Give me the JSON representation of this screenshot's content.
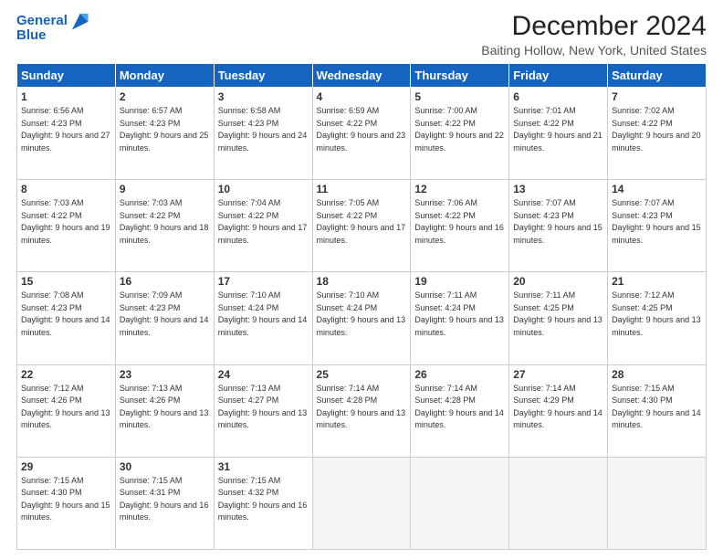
{
  "logo": {
    "line1": "General",
    "line2": "Blue"
  },
  "title": "December 2024",
  "subtitle": "Baiting Hollow, New York, United States",
  "days_header": [
    "Sunday",
    "Monday",
    "Tuesday",
    "Wednesday",
    "Thursday",
    "Friday",
    "Saturday"
  ],
  "weeks": [
    [
      {
        "day": "1",
        "sunrise": "6:56 AM",
        "sunset": "4:23 PM",
        "daylight": "9 hours and 27 minutes."
      },
      {
        "day": "2",
        "sunrise": "6:57 AM",
        "sunset": "4:23 PM",
        "daylight": "9 hours and 25 minutes."
      },
      {
        "day": "3",
        "sunrise": "6:58 AM",
        "sunset": "4:23 PM",
        "daylight": "9 hours and 24 minutes."
      },
      {
        "day": "4",
        "sunrise": "6:59 AM",
        "sunset": "4:22 PM",
        "daylight": "9 hours and 23 minutes."
      },
      {
        "day": "5",
        "sunrise": "7:00 AM",
        "sunset": "4:22 PM",
        "daylight": "9 hours and 22 minutes."
      },
      {
        "day": "6",
        "sunrise": "7:01 AM",
        "sunset": "4:22 PM",
        "daylight": "9 hours and 21 minutes."
      },
      {
        "day": "7",
        "sunrise": "7:02 AM",
        "sunset": "4:22 PM",
        "daylight": "9 hours and 20 minutes."
      }
    ],
    [
      {
        "day": "8",
        "sunrise": "7:03 AM",
        "sunset": "4:22 PM",
        "daylight": "9 hours and 19 minutes."
      },
      {
        "day": "9",
        "sunrise": "7:03 AM",
        "sunset": "4:22 PM",
        "daylight": "9 hours and 18 minutes."
      },
      {
        "day": "10",
        "sunrise": "7:04 AM",
        "sunset": "4:22 PM",
        "daylight": "9 hours and 17 minutes."
      },
      {
        "day": "11",
        "sunrise": "7:05 AM",
        "sunset": "4:22 PM",
        "daylight": "9 hours and 17 minutes."
      },
      {
        "day": "12",
        "sunrise": "7:06 AM",
        "sunset": "4:22 PM",
        "daylight": "9 hours and 16 minutes."
      },
      {
        "day": "13",
        "sunrise": "7:07 AM",
        "sunset": "4:23 PM",
        "daylight": "9 hours and 15 minutes."
      },
      {
        "day": "14",
        "sunrise": "7:07 AM",
        "sunset": "4:23 PM",
        "daylight": "9 hours and 15 minutes."
      }
    ],
    [
      {
        "day": "15",
        "sunrise": "7:08 AM",
        "sunset": "4:23 PM",
        "daylight": "9 hours and 14 minutes."
      },
      {
        "day": "16",
        "sunrise": "7:09 AM",
        "sunset": "4:23 PM",
        "daylight": "9 hours and 14 minutes."
      },
      {
        "day": "17",
        "sunrise": "7:10 AM",
        "sunset": "4:24 PM",
        "daylight": "9 hours and 14 minutes."
      },
      {
        "day": "18",
        "sunrise": "7:10 AM",
        "sunset": "4:24 PM",
        "daylight": "9 hours and 13 minutes."
      },
      {
        "day": "19",
        "sunrise": "7:11 AM",
        "sunset": "4:24 PM",
        "daylight": "9 hours and 13 minutes."
      },
      {
        "day": "20",
        "sunrise": "7:11 AM",
        "sunset": "4:25 PM",
        "daylight": "9 hours and 13 minutes."
      },
      {
        "day": "21",
        "sunrise": "7:12 AM",
        "sunset": "4:25 PM",
        "daylight": "9 hours and 13 minutes."
      }
    ],
    [
      {
        "day": "22",
        "sunrise": "7:12 AM",
        "sunset": "4:26 PM",
        "daylight": "9 hours and 13 minutes."
      },
      {
        "day": "23",
        "sunrise": "7:13 AM",
        "sunset": "4:26 PM",
        "daylight": "9 hours and 13 minutes."
      },
      {
        "day": "24",
        "sunrise": "7:13 AM",
        "sunset": "4:27 PM",
        "daylight": "9 hours and 13 minutes."
      },
      {
        "day": "25",
        "sunrise": "7:14 AM",
        "sunset": "4:28 PM",
        "daylight": "9 hours and 13 minutes."
      },
      {
        "day": "26",
        "sunrise": "7:14 AM",
        "sunset": "4:28 PM",
        "daylight": "9 hours and 14 minutes."
      },
      {
        "day": "27",
        "sunrise": "7:14 AM",
        "sunset": "4:29 PM",
        "daylight": "9 hours and 14 minutes."
      },
      {
        "day": "28",
        "sunrise": "7:15 AM",
        "sunset": "4:30 PM",
        "daylight": "9 hours and 14 minutes."
      }
    ],
    [
      {
        "day": "29",
        "sunrise": "7:15 AM",
        "sunset": "4:30 PM",
        "daylight": "9 hours and 15 minutes."
      },
      {
        "day": "30",
        "sunrise": "7:15 AM",
        "sunset": "4:31 PM",
        "daylight": "9 hours and 16 minutes."
      },
      {
        "day": "31",
        "sunrise": "7:15 AM",
        "sunset": "4:32 PM",
        "daylight": "9 hours and 16 minutes."
      },
      null,
      null,
      null,
      null
    ]
  ]
}
